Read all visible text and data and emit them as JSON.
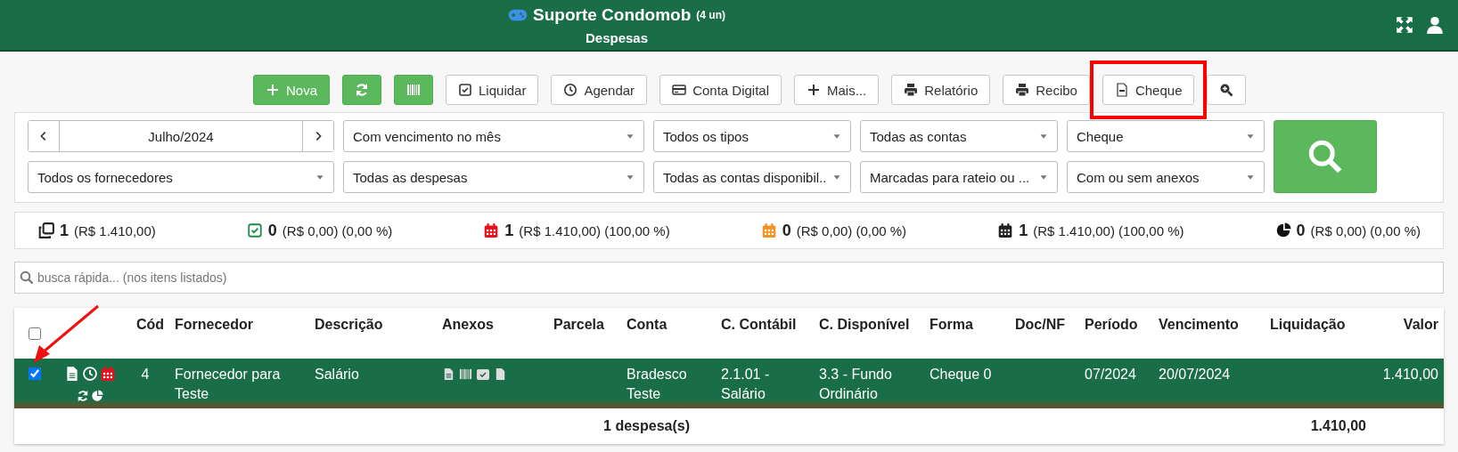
{
  "header": {
    "title": "Suporte Condomob",
    "units": "(4 un)",
    "subtitle": "Despesas"
  },
  "toolbar": [
    {
      "label": "Nova",
      "kind": "primary",
      "highlighted": false
    },
    {
      "kind": "success",
      "highlighted": false
    },
    {
      "kind": "success",
      "highlighted": false
    },
    {
      "label": "Liquidar",
      "kind": "default",
      "highlighted": false
    },
    {
      "label": "Agendar",
      "kind": "default",
      "highlighted": false
    },
    {
      "label": "Conta Digital",
      "kind": "default",
      "highlighted": false
    },
    {
      "label": "Mais...",
      "kind": "default",
      "highlighted": false
    },
    {
      "label": "Relatório",
      "kind": "default",
      "highlighted": false
    },
    {
      "label": "Recibo",
      "kind": "default",
      "highlighted": false
    },
    {
      "label": "Cheque",
      "kind": "default",
      "highlighted": true
    },
    {
      "kind": "default",
      "highlighted": false
    }
  ],
  "filters": {
    "period": "Julho/2024",
    "selects": [
      "Com vencimento no mês",
      "Todos os tipos",
      "Todas as contas",
      "Cheque",
      "Todos os fornecedores",
      "Todas as despesas",
      "Todas as contas disponibil...",
      "Marcadas para rateio ou ...",
      "Com ou sem anexos"
    ]
  },
  "stats": [
    {
      "count": "1",
      "detail": "(R$ 1.410,00)",
      "color": "#222222"
    },
    {
      "count": "0",
      "detail": "(R$ 0,00) (0,00 %)",
      "color": "#1e8a4c"
    },
    {
      "count": "1",
      "detail": "(R$ 1.410,00) (100,00 %)",
      "color": "#e8101a"
    },
    {
      "count": "0",
      "detail": "(R$ 0,00) (0,00 %)",
      "color": "#f39321"
    },
    {
      "count": "1",
      "detail": "(R$ 1.410,00) (100,00 %)",
      "color": "#222222"
    },
    {
      "count": "0",
      "detail": "(R$ 0,00) (0,00 %)",
      "color": "#111111"
    }
  ],
  "quick_search": {
    "placeholder": "busca rápida... (nos itens listados)"
  },
  "table": {
    "all_checked": false,
    "columns": [
      "Cód",
      "Fornecedor",
      "Descrição",
      "Anexos",
      "Parcela",
      "Conta",
      "C. Contábil",
      "C. Disponível",
      "Forma",
      "Doc/NF",
      "Período",
      "Vencimento",
      "Liquidação",
      "Valor"
    ],
    "rows": [
      {
        "selected": true,
        "checked": true,
        "cells": [
          "4",
          "Fornecedor para Teste",
          "Salário",
          "",
          "",
          "Bradesco Teste",
          "2.1.01 - Salário",
          "3.3 - Fundo Ordinário",
          "Cheque 0",
          "",
          "07/2024",
          "20/07/2024",
          "",
          "1.410,00"
        ]
      }
    ],
    "footer": {
      "count": "1 despesa(s)",
      "total": "1.410,00"
    }
  }
}
